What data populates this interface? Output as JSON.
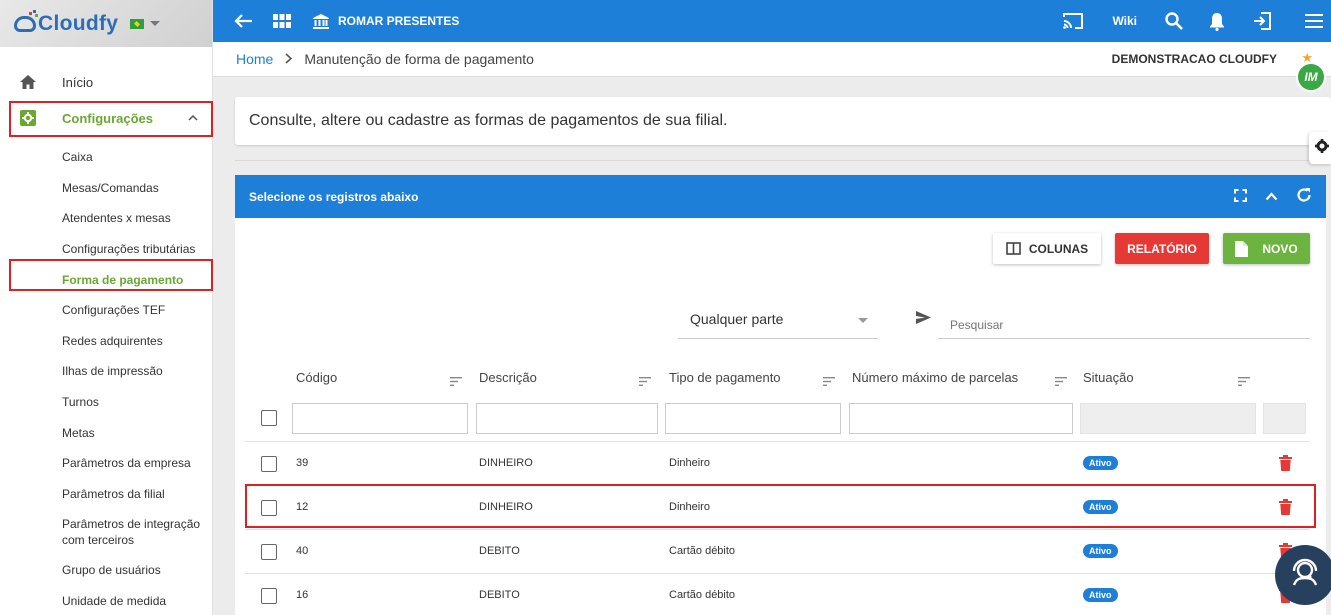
{
  "app": {
    "logo_text": "Cloudfy"
  },
  "topbar": {
    "company": "ROMAR PRESENTES",
    "wiki": "Wiki"
  },
  "breadcrumb": {
    "home": "Home",
    "current": "Manutenção de forma de pagamento"
  },
  "user": {
    "account": "DEMONSTRACAO CLOUDFY",
    "avatar_initials": "IM"
  },
  "sidebar": {
    "top_items": [
      {
        "label": "Início",
        "icon": "home-icon"
      },
      {
        "label": "Configurações",
        "icon": "settings-icon"
      }
    ],
    "sub_items": [
      "Caixa",
      "Mesas/Comandas",
      "Atendentes x mesas",
      "Configurações tributárias",
      "Forma de pagamento",
      "Configurações TEF",
      "Redes adquirentes",
      "Ilhas de impressão",
      "Turnos",
      "Metas",
      "Parâmetros da empresa",
      "Parâmetros da filial",
      "Parâmetros de integração com terceiros",
      "Grupo de usuários",
      "Unidade de medida"
    ]
  },
  "info": {
    "text": "Consulte, altere ou cadastre as formas de pagamentos de sua filial."
  },
  "panel": {
    "title": "Selecione os registros abaixo",
    "buttons": {
      "columns": "COLUNAS",
      "report": "RELATÓRIO",
      "new": "NOVO"
    },
    "search": {
      "mode": "Qualquer parte",
      "placeholder": "Pesquisar"
    },
    "columns": [
      "Código",
      "Descrição",
      "Tipo de pagamento",
      "Número máximo de parcelas",
      "Situação"
    ],
    "rows": [
      {
        "code": "39",
        "description": "DINHEIRO",
        "type": "Dinheiro",
        "max_installments": "",
        "status": "Ativo"
      },
      {
        "code": "12",
        "description": "DINHEIRO",
        "type": "Dinheiro",
        "max_installments": "",
        "status": "Ativo"
      },
      {
        "code": "40",
        "description": "DEBITO",
        "type": "Cartão débito",
        "max_installments": "",
        "status": "Ativo"
      },
      {
        "code": "16",
        "description": "DEBITO",
        "type": "Cartão débito",
        "max_installments": "",
        "status": "Ativo"
      }
    ]
  },
  "colors": {
    "primary": "#1e7fd8",
    "accent_green": "#6aa832",
    "danger": "#e53935",
    "highlight": "#e02020"
  }
}
